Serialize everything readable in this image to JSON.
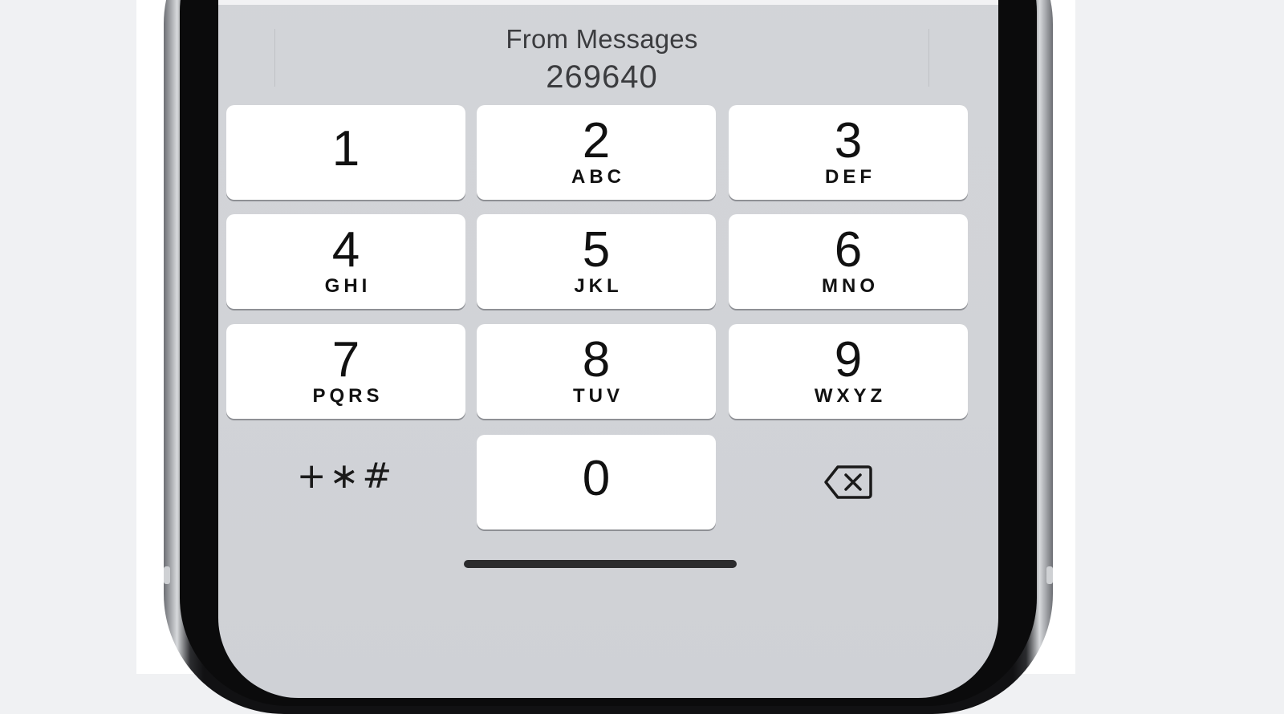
{
  "suggestion": {
    "source": "From Messages",
    "code": "269640"
  },
  "keypad": {
    "keys": [
      {
        "digit": "1",
        "letters": ""
      },
      {
        "digit": "2",
        "letters": "ABC"
      },
      {
        "digit": "3",
        "letters": "DEF"
      },
      {
        "digit": "4",
        "letters": "GHI"
      },
      {
        "digit": "5",
        "letters": "JKL"
      },
      {
        "digit": "6",
        "letters": "MNO"
      },
      {
        "digit": "7",
        "letters": "PQRS"
      },
      {
        "digit": "8",
        "letters": "TUV"
      },
      {
        "digit": "9",
        "letters": "WXYZ"
      },
      {
        "digit": "0",
        "letters": ""
      }
    ],
    "symbols_label": "+∗#",
    "delete_icon": "backspace-icon"
  },
  "colors": {
    "screen_background": "#d3d4d8",
    "key_background": "#ffffff",
    "text": "#111111"
  }
}
